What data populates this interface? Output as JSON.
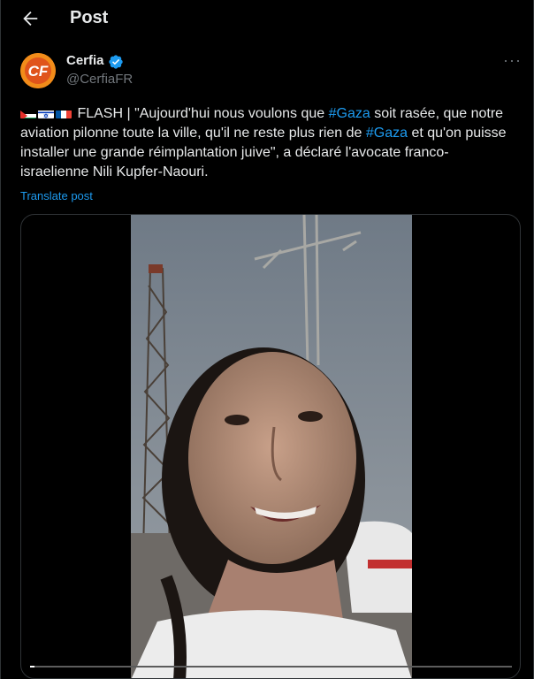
{
  "header": {
    "title": "Post"
  },
  "author": {
    "name": "Cerfia",
    "handle": "@CerfiaFR",
    "avatar_text": "CF"
  },
  "post": {
    "segments": [
      {
        "text": "FLASH | \"Aujourd'hui nous voulons que ",
        "type": "text"
      },
      {
        "text": "#Gaza",
        "type": "hashtag"
      },
      {
        "text": " soit rasée, que notre aviation pilonne toute la ville, qu'il ne reste plus rien de ",
        "type": "text"
      },
      {
        "text": "#Gaza",
        "type": "hashtag"
      },
      {
        "text": " et qu'on puisse installer une grande réimplantation juive\", a déclaré l'avocate franco-israelienne Nili Kupfer-Naouri.",
        "type": "text"
      }
    ],
    "flags": [
      "palestine-flag-icon",
      "israel-flag-icon",
      "france-flag-icon"
    ],
    "translate_label": "Translate post"
  },
  "video": {
    "progress": 0.01
  },
  "colors": {
    "accent": "#1d9bf0",
    "verified": "#1d9bf0",
    "avatar_bg": "#f28c1a"
  }
}
